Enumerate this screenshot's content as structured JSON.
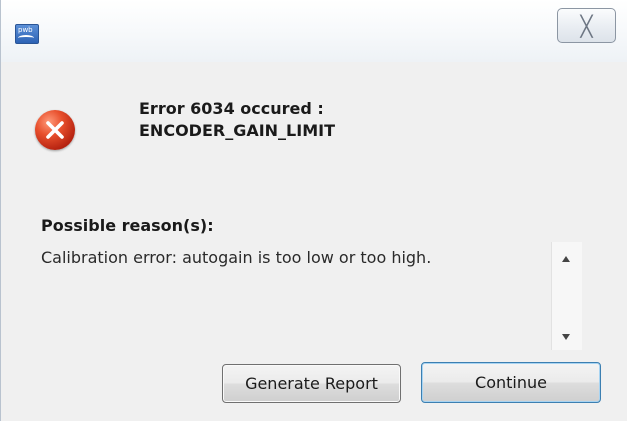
{
  "window": {
    "app_icon_text": "pwb",
    "close_label": "╳"
  },
  "error": {
    "title": "Error 6034 occured :",
    "code": "ENCODER_GAIN_LIMIT",
    "icon": "error-x-icon",
    "icon_color": "#d63c1e"
  },
  "reasons": {
    "heading": "Possible reason(s):",
    "text": "Calibration error: autogain is too low or too high."
  },
  "buttons": {
    "report_label": "Generate Report",
    "continue_label": "Continue"
  }
}
